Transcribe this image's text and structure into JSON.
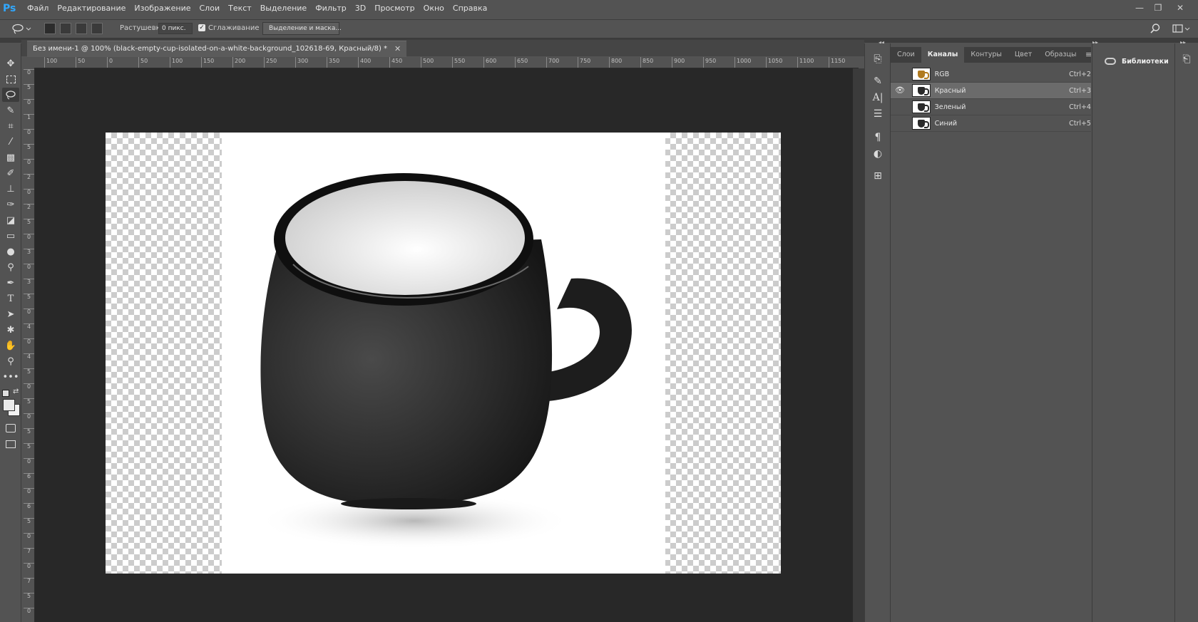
{
  "app": {
    "logo": "Ps"
  },
  "menu": [
    "Файл",
    "Редактирование",
    "Изображение",
    "Слои",
    "Текст",
    "Выделение",
    "Фильтр",
    "3D",
    "Просмотр",
    "Окно",
    "Справка"
  ],
  "window_controls": {
    "minimize": "—",
    "restore": "❐",
    "close": "✕"
  },
  "options": {
    "feather_label": "Растушевка:",
    "feather_value": "0 пикс.",
    "antialias_label": "Сглаживание",
    "antialias_checked": "✓",
    "select_mask_button": "Выделение и маска..."
  },
  "document": {
    "tab_title": "Без имени-1 @ 100% (black-empty-cup-isolated-on-a-white-background_102618-69, Красный/8) *",
    "close": "✕"
  },
  "ruler": {
    "horizontal": [
      "100",
      "50",
      "0",
      "50",
      "100",
      "150",
      "200",
      "250",
      "300",
      "350",
      "400",
      "450",
      "500",
      "550",
      "600",
      "650",
      "700",
      "750",
      "800",
      "850",
      "900",
      "950",
      "1000",
      "1050",
      "1100",
      "1150"
    ],
    "vertical": [
      "0",
      "5",
      "0",
      "1",
      "0",
      "5",
      "0",
      "2",
      "0",
      "2",
      "5",
      "0",
      "3",
      "0",
      "3",
      "5",
      "0",
      "4",
      "0",
      "4",
      "5",
      "0",
      "5",
      "0",
      "5",
      "5",
      "0",
      "6",
      "0",
      "6",
      "5",
      "0",
      "7",
      "0",
      "7",
      "5",
      "0"
    ]
  },
  "panel": {
    "tabs": [
      "Слои",
      "Каналы",
      "Контуры",
      "Цвет",
      "Образцы"
    ],
    "active_tab": "Каналы",
    "menu_icon": "≡",
    "channels": [
      {
        "name": "RGB",
        "shortcut": "Ctrl+2",
        "visible": false,
        "selected": false
      },
      {
        "name": "Красный",
        "shortcut": "Ctrl+3",
        "visible": true,
        "selected": true
      },
      {
        "name": "Зеленый",
        "shortcut": "Ctrl+4",
        "visible": false,
        "selected": false
      },
      {
        "name": "Синий",
        "shortcut": "Ctrl+5",
        "visible": false,
        "selected": false
      }
    ]
  },
  "libraries": {
    "label": "Библиотеки"
  },
  "colors": {
    "accent": "#31a8ff",
    "workspace": "#282828",
    "panel": "#535353"
  }
}
